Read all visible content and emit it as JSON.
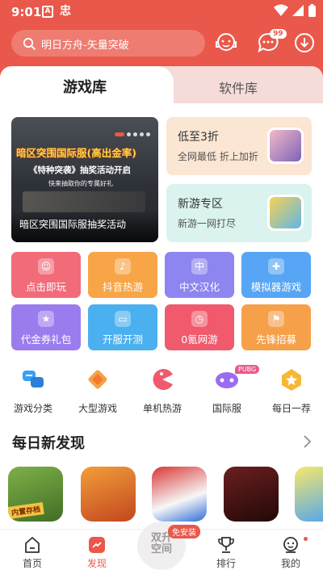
{
  "status_bar": {
    "time": "9:01",
    "notif_icons": [
      "A",
      "忠"
    ]
  },
  "search": {
    "placeholder": "明日方舟-矢量突破"
  },
  "header": {
    "message_badge": "99"
  },
  "tabs": {
    "game_library": "游戏库",
    "software_library": "软件库"
  },
  "banner": {
    "headline": "暗区突围国际服(高出金率)",
    "subline": "《特种突袭》抽奖活动开启",
    "tagline": "快来抽取你的专属好礼",
    "caption": "暗区突围国际服抽奖活动",
    "slide_count": 5,
    "active_slide": 1
  },
  "promos": [
    {
      "title": "低至3折",
      "subtitle": "全网最低 折上加折",
      "bg": "#fbe6d3"
    },
    {
      "title": "新游专区",
      "subtitle": "新游一网打尽",
      "bg": "#daf3ee"
    }
  ],
  "feature_grid": [
    {
      "label": "点击即玩",
      "color": "#f26b79"
    },
    {
      "label": "抖音热游",
      "color": "#f7a547"
    },
    {
      "label": "中文汉化",
      "color": "#8e86f0"
    },
    {
      "label": "模拟器游戏",
      "color": "#57a5f5"
    },
    {
      "label": "代金券礼包",
      "color": "#9a7cef"
    },
    {
      "label": "开服开测",
      "color": "#4ab0ef"
    },
    {
      "label": "0氪网游",
      "color": "#f05a6c"
    },
    {
      "label": "先锋招募",
      "color": "#f6a04a"
    }
  ],
  "categories": [
    {
      "label": "游戏分类",
      "icon": "category-icon"
    },
    {
      "label": "大型游戏",
      "icon": "puzzle-icon"
    },
    {
      "label": "单机热游",
      "icon": "pacman-icon"
    },
    {
      "label": "国际服",
      "icon": "gamepad-icon",
      "badge": "PUBG"
    },
    {
      "label": "每日一荐",
      "icon": "star-medal-icon"
    }
  ],
  "daily": {
    "title": "每日新发现",
    "apps": [
      {
        "name": "app-1",
        "tag": "内置存档"
      },
      {
        "name": "app-2"
      },
      {
        "name": "app-3"
      },
      {
        "name": "app-4"
      },
      {
        "name": "app-5"
      }
    ]
  },
  "bottom_nav": {
    "items": [
      {
        "label": "首页",
        "icon": "home-icon"
      },
      {
        "label": "发现",
        "icon": "discover-icon",
        "active": true
      },
      {
        "label": "双升空间",
        "icon": "space-icon"
      },
      {
        "label": "排行",
        "icon": "trophy-icon"
      },
      {
        "label": "我的",
        "icon": "profile-icon"
      }
    ],
    "center_line1": "双升",
    "center_line2": "空间",
    "free_install": "免安装"
  },
  "colors": {
    "accent": "#e9584a"
  }
}
